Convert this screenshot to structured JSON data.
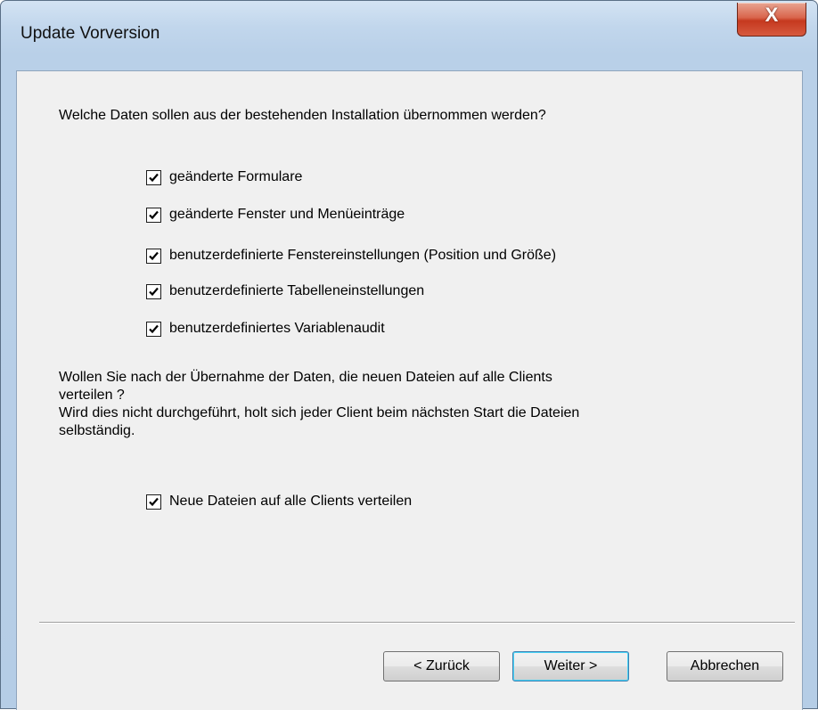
{
  "window": {
    "title": "Update Vorversion",
    "close_glyph": "X"
  },
  "content": {
    "question": "Welche Daten sollen aus der bestehenden Installation übernommen werden?",
    "options": [
      {
        "label": "geänderte Formulare",
        "checked": true
      },
      {
        "label": "geänderte Fenster und Menüeinträge",
        "checked": true
      },
      {
        "label": "benutzerdefinierte Fenstereinstellungen (Position und Größe)",
        "checked": true
      },
      {
        "label": "benutzerdefinierte Tabelleneinstellungen",
        "checked": true
      },
      {
        "label": "benutzerdefiniertes Variablenaudit",
        "checked": true
      }
    ],
    "distribute_question_line1": "Wollen Sie nach der Übernahme der Daten, die neuen Dateien auf alle Clients",
    "distribute_question_line2": "verteilen ?",
    "distribute_note_line1": "Wird dies nicht durchgeführt, holt sich jeder Client beim nächsten Start die Dateien",
    "distribute_note_line2": "selbständig.",
    "distribute_option": {
      "label": "Neue Dateien auf alle Clients verteilen",
      "checked": true
    }
  },
  "buttons": {
    "back": "< Zurück",
    "next": "Weiter >",
    "cancel": "Abbrechen"
  }
}
